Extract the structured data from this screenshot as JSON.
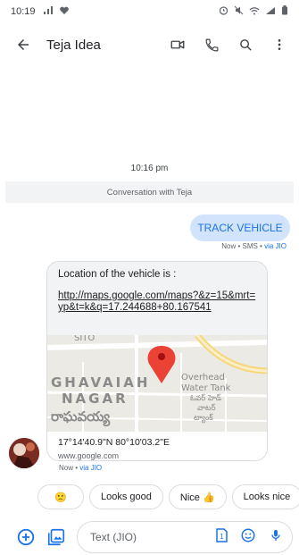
{
  "status_bar": {
    "time": "10:19"
  },
  "app_bar": {
    "title": "Teja Idea"
  },
  "thread": {
    "timestamp": "10:16 pm",
    "banner": "Conversation with Teja"
  },
  "outgoing": {
    "text": "TRACK VEHICLE",
    "meta": "Now • SMS • ",
    "via": "via JIO"
  },
  "incoming": {
    "line": "Location of the vehicle is :",
    "link": "http://maps.google.com/maps?&z=15&mrt=yp&t=k&q=17.244688+80.167541",
    "map": {
      "label_top": "SITO",
      "label_area_1": "GHAVAIAH",
      "label_area_2": "NAGAR",
      "label_telugu": "రాఘవయ్య",
      "label_poi_1": "Overhead",
      "label_poi_2": "Water Tank",
      "label_poi_te_1": "ఓవర్ హెడ్",
      "label_poi_te_2": "వాటర్",
      "label_poi_te_3": "ట్యాంక్"
    },
    "coords": "17°14'40.9\"N 80°10'03.2\"E",
    "domain": "www.google.com",
    "meta": "Now • ",
    "via": "via JIO"
  },
  "suggestions": {
    "emoji": "🙁",
    "chip_1": "Looks good",
    "chip_2": "Nice 👍",
    "chip_3": "Looks nice"
  },
  "composer": {
    "placeholder": "Text (JIO)"
  },
  "colors": {
    "accent": "#1a73e8",
    "bubble_out": "#d2e3fc",
    "bubble_in": "#f1f3f4",
    "pin": "#ea4335"
  }
}
